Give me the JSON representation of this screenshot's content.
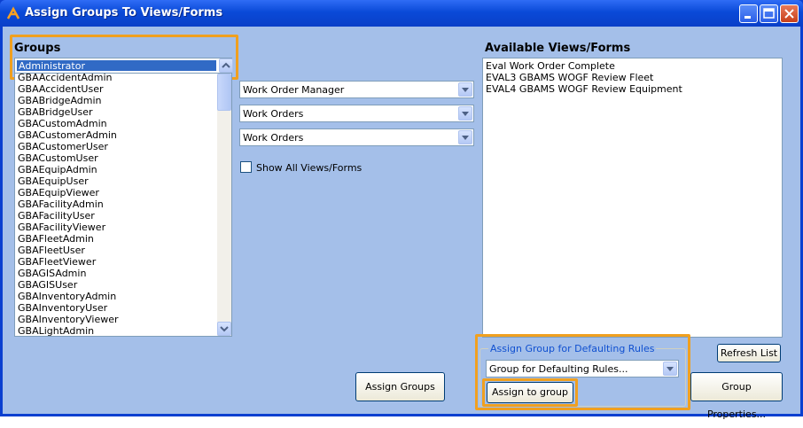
{
  "window": {
    "title": "Assign Groups To Views/Forms"
  },
  "groups": {
    "label": "Groups",
    "selected": "Administrator",
    "items": [
      "GBAAccidentAdmin",
      "GBAAccidentUser",
      "GBABridgeAdmin",
      "GBABridgeUser",
      "GBACustomAdmin",
      "GBACustomerAdmin",
      "GBACustomerUser",
      "GBACustomUser",
      "GBAEquipAdmin",
      "GBAEquipUser",
      "GBAEquipViewer",
      "GBAFacilityAdmin",
      "GBAFacilityUser",
      "GBAFacilityViewer",
      "GBAFleetAdmin",
      "GBAFleetUser",
      "GBAFleetViewer",
      "GBAGISAdmin",
      "GBAGISUser",
      "GBAInventoryAdmin",
      "GBAInventoryUser",
      "GBAInventoryViewer",
      "GBALightAdmin"
    ]
  },
  "filters": {
    "combo1": "Work Order Manager",
    "combo2": "Work Orders",
    "combo3": "Work Orders",
    "show_all_label": "Show All Views/Forms"
  },
  "available": {
    "label": "Available Views/Forms",
    "items": [
      "Eval Work Order Complete",
      "EVAL3 GBAMS WOGF Review Fleet",
      "EVAL4 GBAMS WOGF Review Equipment"
    ]
  },
  "buttons": {
    "assign_groups": "Assign Groups",
    "refresh_list": "Refresh List",
    "group_properties": "Group Properties...",
    "assign_to_group": "Assign to group"
  },
  "defaulting": {
    "legend": "Assign Group for Defaulting Rules",
    "combo": "Group for Defaulting Rules..."
  }
}
